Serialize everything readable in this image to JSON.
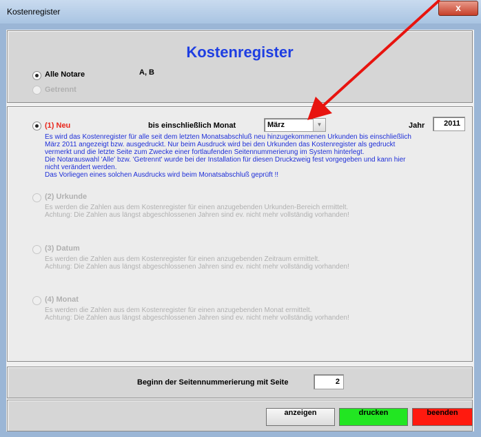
{
  "window": {
    "title": "Kostenregister",
    "close_glyph": "x"
  },
  "header": {
    "heading": "Kostenregister"
  },
  "notare": {
    "alle_label": "Alle Notare",
    "alle_value": "A, B",
    "getrennt_label": "Getrennt"
  },
  "options": {
    "neu": {
      "label": "(1) Neu",
      "month_label": "bis einschließlich Monat",
      "month_value": "März",
      "year_label": "Jahr",
      "year_value": "2011",
      "description": "Es wird das Kostenregister für alle seit dem letzten Monatsabschluß neu hinzugekommenen Urkunden bis einschließlich\nMärz 2011 angezeigt bzw. ausgedruckt. Nur beim Ausdruck wird bei den Urkunden das Kostenregister als gedruckt\nvermerkt und die letzte Seite zum Zwecke einer fortlaufenden Seitennummerierung im System hinterlegt.\nDie Notarauswahl 'Alle' bzw. 'Getrennt' wurde bei der Installation für diesen Druckzweig fest vorgegeben und kann hier\nnicht verändert werden.\nDas Vorliegen eines solchen Ausdrucks wird beim Monatsabschluß geprüft !!"
    },
    "urkunde": {
      "label": "(2) Urkunde",
      "description": "Es werden die Zahlen aus dem Kostenregister für einen anzugebenden Urkunden-Bereich ermittelt.\nAchtung: Die Zahlen aus längst abgeschlossenen Jahren sind ev. nicht mehr vollständig vorhanden!"
    },
    "datum": {
      "label": "(3) Datum",
      "description": "Es werden die Zahlen aus dem Kostenregister für einen anzugebenden Zeitraum ermittelt.\nAchtung: Die Zahlen aus längst abgeschlossenen Jahren sind ev. nicht mehr vollständig vorhanden!"
    },
    "monat": {
      "label": "(4) Monat",
      "description": "Es werden die Zahlen aus dem Kostenregister für einen anzugebenden Monat ermittelt.\nAchtung: Die Zahlen aus längst abgeschlossenen Jahren sind ev. nicht mehr vollständig vorhanden!"
    }
  },
  "seiten": {
    "label": "Beginn der Seitennummerierung mit Seite",
    "value": "2"
  },
  "buttons": {
    "anzeigen": "anzeigen",
    "drucken": "drucken",
    "beenden": "beenden"
  },
  "colors": {
    "heading": "#1e3ee2",
    "neu_label": "#e8251a",
    "description": "#1e2fd8",
    "drucken_bg": "#22e622",
    "beenden_bg": "#ff1a0f",
    "annotation_arrow": "#e8140f"
  },
  "icons": {
    "dropdown": "chevron-down-icon",
    "close": "close-icon",
    "annotation": "red-arrow-annotation"
  }
}
